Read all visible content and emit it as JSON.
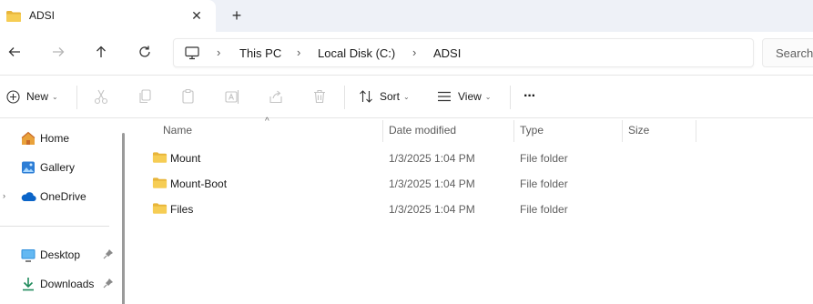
{
  "tab": {
    "title": "ADSI",
    "close_glyph": "✕",
    "new_tab_glyph": "+"
  },
  "nav": {
    "back_icon": "arrow-left-icon",
    "forward_icon": "arrow-right-icon",
    "up_icon": "arrow-up-icon",
    "refresh_icon": "refresh-icon"
  },
  "breadcrumb": {
    "items": [
      "This PC",
      "Local Disk (C:)",
      "ADSI"
    ],
    "separator": "›"
  },
  "search": {
    "placeholder": "Search"
  },
  "commands": {
    "new_label": "New",
    "sort_label": "Sort",
    "view_label": "View",
    "more_glyph": "···"
  },
  "sidebar": {
    "items": [
      {
        "label": "Home",
        "icon": "home-icon"
      },
      {
        "label": "Gallery",
        "icon": "gallery-icon"
      },
      {
        "label": "OneDrive",
        "icon": "cloud-icon"
      },
      {
        "label": "Desktop",
        "icon": "desktop-icon"
      },
      {
        "label": "Downloads",
        "icon": "download-icon"
      }
    ]
  },
  "columns": [
    "Name",
    "Date modified",
    "Type",
    "Size"
  ],
  "files": [
    {
      "name": "Mount",
      "date": "1/3/2025 1:04 PM",
      "type": "File folder"
    },
    {
      "name": "Mount-Boot",
      "date": "1/3/2025 1:04 PM",
      "type": "File folder"
    },
    {
      "name": "Files",
      "date": "1/3/2025 1:04 PM",
      "type": "File folder"
    }
  ],
  "colors": {
    "folder": "#f4c542",
    "accent": "#0067c0",
    "tabstrip_bg": "#eef1f7"
  }
}
